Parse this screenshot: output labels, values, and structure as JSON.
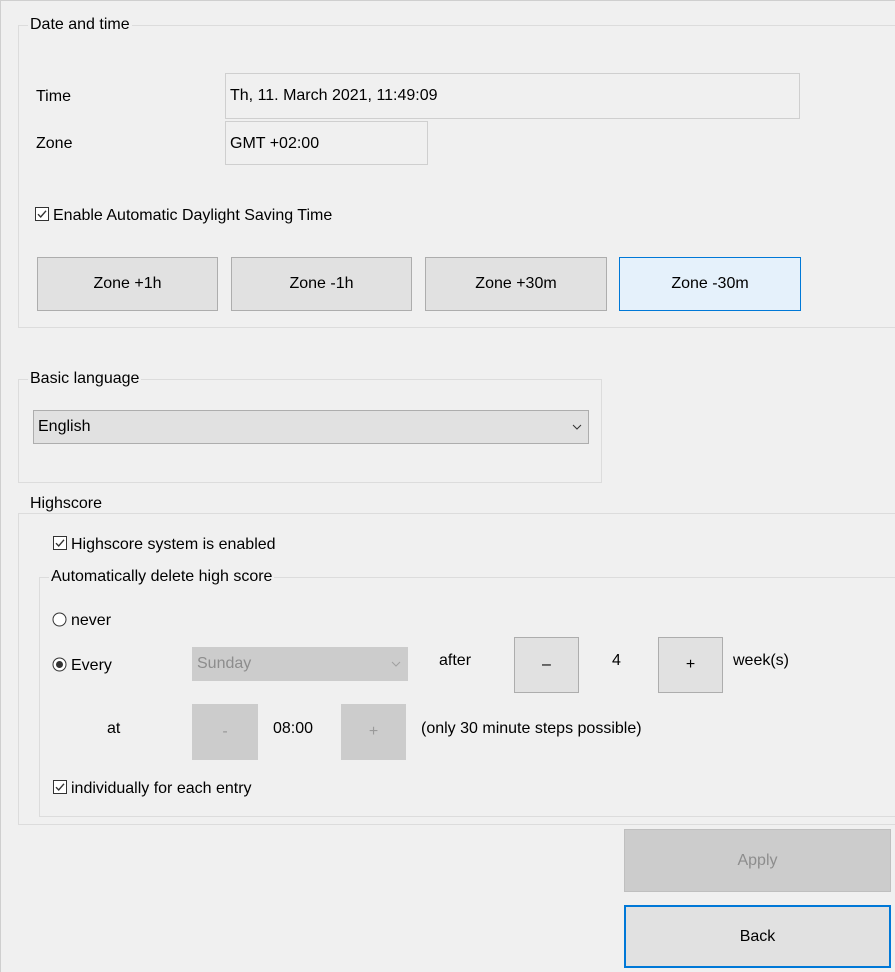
{
  "date_time": {
    "legend": "Date and time",
    "time_label": "Time",
    "time_value": "Th, 11. March 2021, 11:49:09",
    "zone_label": "Zone",
    "zone_value": "GMT +02:00",
    "dst_label": "Enable Automatic Daylight Saving Time",
    "dst_checked": true,
    "buttons": [
      "Zone +1h",
      "Zone -1h",
      "Zone +30m",
      "Zone -30m"
    ]
  },
  "language": {
    "legend": "Basic language",
    "selected": "English"
  },
  "highscore": {
    "legend": "Highscore",
    "enabled_label": "Highscore system is enabled",
    "enabled_checked": true,
    "auto_delete": {
      "legend": "Automatically delete high score",
      "never_label": "never",
      "every_label": "Every",
      "every_selected": true,
      "day_selected": "Sunday",
      "after_label": "after",
      "minus_label": "–",
      "weeks_value": "4",
      "plus_label": "+",
      "weeks_unit": "week(s)",
      "at_label": "at",
      "time_minus_label": "-",
      "time_value": "08:00",
      "time_plus_label": "+",
      "time_note": "(only 30 minute steps possible)",
      "individual_label": "individually for each entry",
      "individual_checked": true
    }
  },
  "actions": {
    "apply_label": "Apply",
    "back_label": "Back"
  },
  "colors": {
    "background": "#f0f0f0",
    "selected_button_bg": "#e5f1fb",
    "selected_button_border": "#0078d7",
    "disabled_bg": "#cccccc"
  }
}
